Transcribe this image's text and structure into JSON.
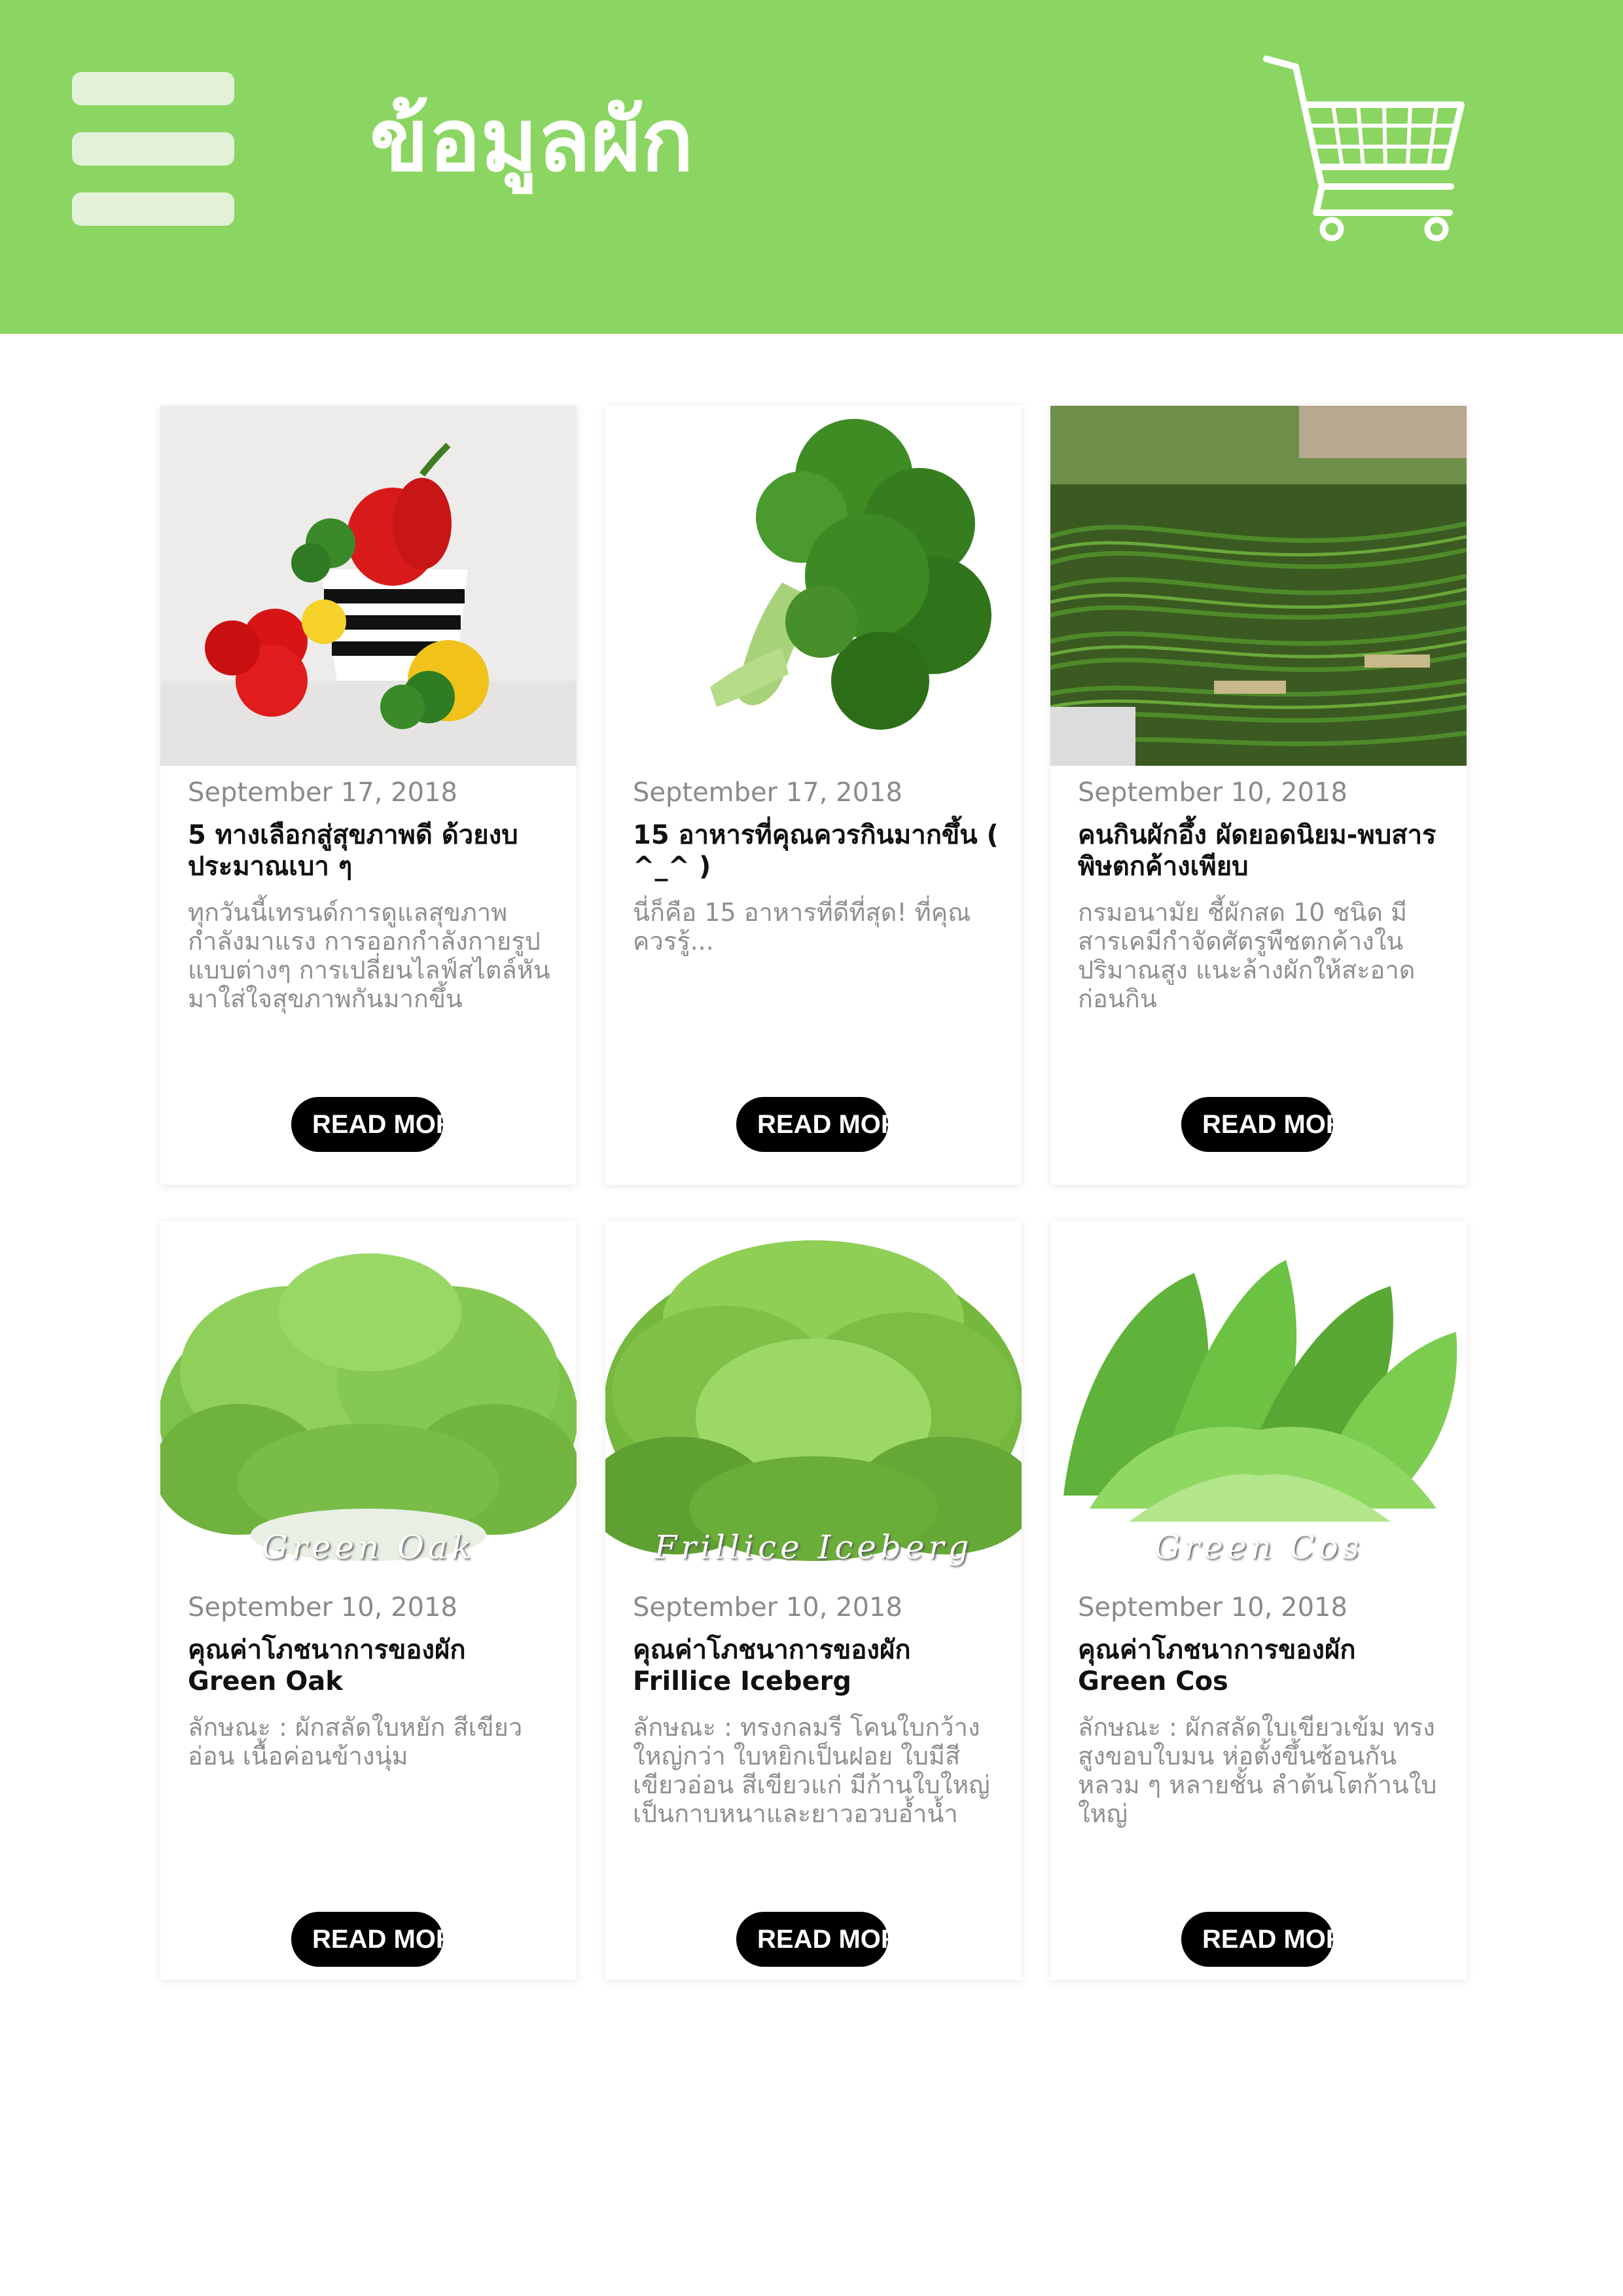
{
  "header": {
    "title": "ข้อมูลผัก",
    "background_color": "#8bd562",
    "menu_icon": "hamburger-menu-icon",
    "cart_icon": "shopping-cart-icon"
  },
  "cards": [
    {
      "date": "September 17, 2018",
      "title": "5 ทางเลือกสู่สุขภาพดี ด้วยงบประมาณเบา ๆ",
      "description": "ทุกวันนี้เทรนด์การดูแลสุขภาพกำลังมาแรง การออกกำลังกายรูปแบบต่างๆ การเปลี่ยนไลฟ์สไตล์หันมาใส่ใจสุขภาพกันมากขึ้น",
      "button_label": "READ MORE",
      "image": "vegetables-bowl-photo"
    },
    {
      "date": "September 17, 2018",
      "title": "15 อาหารที่คุณควรกินมากขึ้น ( ^_^ )",
      "description": "นี่ก็คือ 15 อาหารที่ดีที่สุด! ที่คุณควรรู้...",
      "button_label": "READ MORE",
      "image": "broccoli-photo"
    },
    {
      "date": "September 10, 2018",
      "title": "คนกินผักอึ้ง ผัดยอดนิยม-พบสารพิษตกค้างเพียบ",
      "description": "กรมอนามัย ชี้ผักสด 10 ชนิด มีสารเคมีกำจัดศัตรูพืชตกค้างในปริมาณสูง แนะล้างผักให้สะอาดก่อนกิน",
      "button_label": "READ MORE",
      "image": "long-beans-photo"
    },
    {
      "date": "September 10, 2018",
      "title": "คุณค่าโภชนาการของผัก Green Oak",
      "description": "ลักษณะ : ผักสลัดใบหยัก สีเขียวอ่อน เนื้อค่อนข้างนุ่ม",
      "button_label": "READ MORE",
      "image": "green-oak-lettuce-photo",
      "image_caption": "Green Oak"
    },
    {
      "date": "September 10, 2018",
      "title": "คุณค่าโภชนาการของผัก Frillice Iceberg",
      "description": "ลักษณะ : ทรงกลมรี โคนใบกว้างใหญ่กว่า ใบหยิกเป็นฝอย ใบมีสีเขียวอ่อน สีเขียวแก่ มีก้านใบใหญ่ เป็นกาบหนาและยาวอวบอ้ำน้ำ",
      "button_label": "READ MORE",
      "image": "frillice-iceberg-lettuce-photo",
      "image_caption": "Frillice Iceberg"
    },
    {
      "date": "September 10, 2018",
      "title": "คุณค่าโภชนาการของผัก Green Cos",
      "description": "ลักษณะ : ผักสลัดใบเขียวเข้ม ทรงสูงขอบใบมน ห่อตั้งขึ้นซ้อนกันหลวม ๆ หลายชั้น ลำต้นโตก้านใบใหญ่",
      "button_label": "READ MORE",
      "image": "green-cos-lettuce-photo",
      "image_caption": "Green Cos"
    }
  ]
}
